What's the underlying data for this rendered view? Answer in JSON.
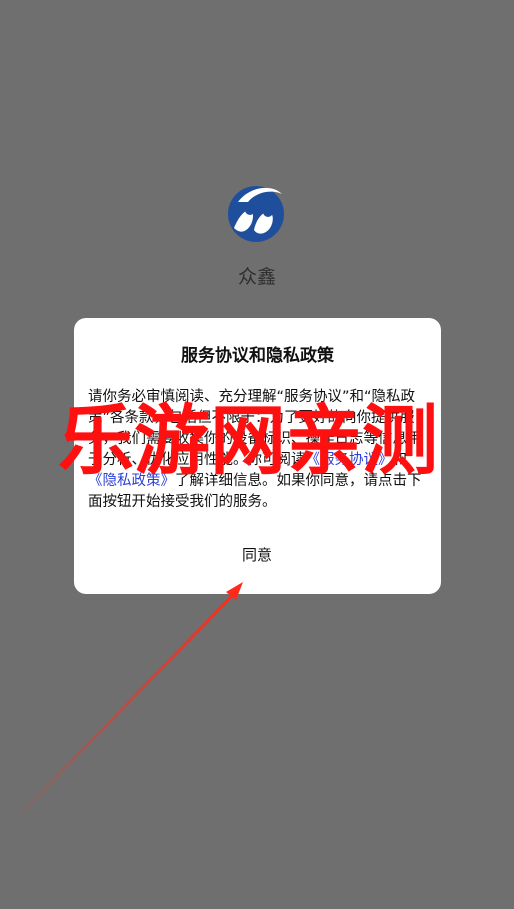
{
  "app": {
    "name": "众鑫",
    "logo_icon": "app-logo-icon"
  },
  "dialog": {
    "title": "服务协议和隐私政策",
    "body_part1": "请你务必审慎阅读、充分理解“服务协议”和“隐私政策”各条款，包括但不限于：为了更好的向你提供服务，我们需要收集你的设备标识、操作日志等信息用于分析、优化应用性能。你可阅读",
    "link_service": "《服务协议》",
    "body_and": "和",
    "link_privacy": "《隐私政策》",
    "body_part2": "了解详细信息。如果你同意，请点击下面按钮开始接受我们的服务。",
    "agree_label": "同意"
  },
  "watermark": {
    "text": "乐游网亲测"
  },
  "colors": {
    "overlay_bg": "#6f6f6f",
    "dialog_bg": "#ffffff",
    "link": "#2b3fd6",
    "watermark": "#ff1010",
    "logo_blue": "#1f4f9c"
  }
}
